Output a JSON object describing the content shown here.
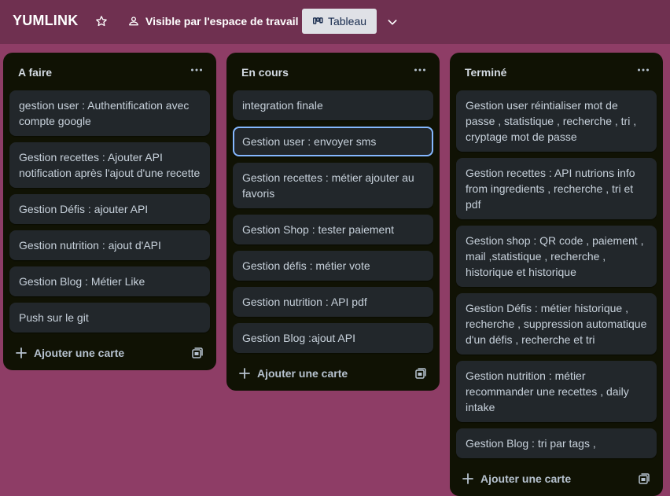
{
  "header": {
    "board_title": "YUMLINK",
    "visibility_label": "Visible par l'espace de travail",
    "view_label": "Tableau"
  },
  "lists": [
    {
      "title": "A faire",
      "cards": [
        "gestion user : Authentification avec compte google",
        "Gestion recettes : Ajouter API notification après l'ajout d'une recette",
        "Gestion Défis : ajouter API",
        "Gestion nutrition : ajout d'API",
        "Gestion Blog : Métier Like",
        "Push sur le git"
      ],
      "add_card_label": "Ajouter une carte"
    },
    {
      "title": "En cours",
      "cards": [
        "integration finale",
        "Gestion user : envoyer sms",
        "Gestion recettes : métier ajouter au favoris",
        "Gestion Shop : tester paiement",
        "Gestion défis : métier vote",
        "Gestion nutrition : API pdf",
        "Gestion Blog :ajout API"
      ],
      "add_card_label": "Ajouter une carte"
    },
    {
      "title": "Terminé",
      "cards": [
        "Gestion user réintialiser mot de passe , statistique , recherche , tri , cryptage mot de passe",
        "Gestion recettes : API nutrions info from ingredients , recherche , tri et pdf",
        "Gestion shop : QR code , paiement , mail ,statistique , recherche , historique et historique",
        "Gestion Défis : métier historique , recherche , suppression automatique d'un défis , recherche et tri",
        "Gestion nutrition : métier recommander une recettes , daily intake",
        "Gestion Blog : tri par tags ,"
      ],
      "add_card_label": "Ajouter une carte"
    }
  ],
  "icons": {
    "star": "star-icon",
    "visibility": "people-icon",
    "board_view": "board-icon",
    "chevron": "chevron-down-icon",
    "list_menu": "more-icon",
    "add": "plus-icon",
    "template": "template-icon"
  },
  "colors": {
    "background": "#8e3d66",
    "header": "#6f3050",
    "list": "#101204",
    "card": "#22272b",
    "selected_outline": "#85b8ff"
  }
}
